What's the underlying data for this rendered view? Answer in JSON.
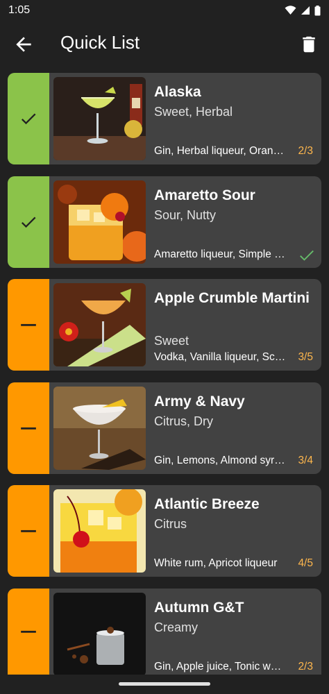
{
  "status_bar": {
    "time": "1:05"
  },
  "app_bar": {
    "title": "Quick List"
  },
  "colors": {
    "done": "#8BC34A",
    "partial": "#FF9800",
    "count": "#FFB74D",
    "card": "#424242",
    "background": "#212121"
  },
  "cocktails": [
    {
      "name": "Alaska",
      "flavor": "Sweet, Herbal",
      "ingredients": "Gin, Herbal liqueur, Orange bitters",
      "count": "2/3",
      "status": "done"
    },
    {
      "name": "Amaretto Sour",
      "flavor": "Sour, Nutty",
      "ingredients": "Amaretto liqueur, Simple syrup",
      "count": "",
      "status": "done"
    },
    {
      "name": "Apple Crumble Martini",
      "flavor": "Sweet",
      "ingredients": "Vodka, Vanilla liqueur, Schnapps",
      "count": "3/5",
      "status": "partial"
    },
    {
      "name": "Army & Navy",
      "flavor": "Citrus, Dry",
      "ingredients": "Gin, Lemons, Almond syrup",
      "count": "3/4",
      "status": "partial"
    },
    {
      "name": "Atlantic Breeze",
      "flavor": "Citrus",
      "ingredients": "White rum, Apricot liqueur",
      "count": "4/5",
      "status": "partial"
    },
    {
      "name": "Autumn G&T",
      "flavor": "Creamy",
      "ingredients": "Gin, Apple juice, Tonic water",
      "count": "2/3",
      "status": "partial"
    }
  ]
}
